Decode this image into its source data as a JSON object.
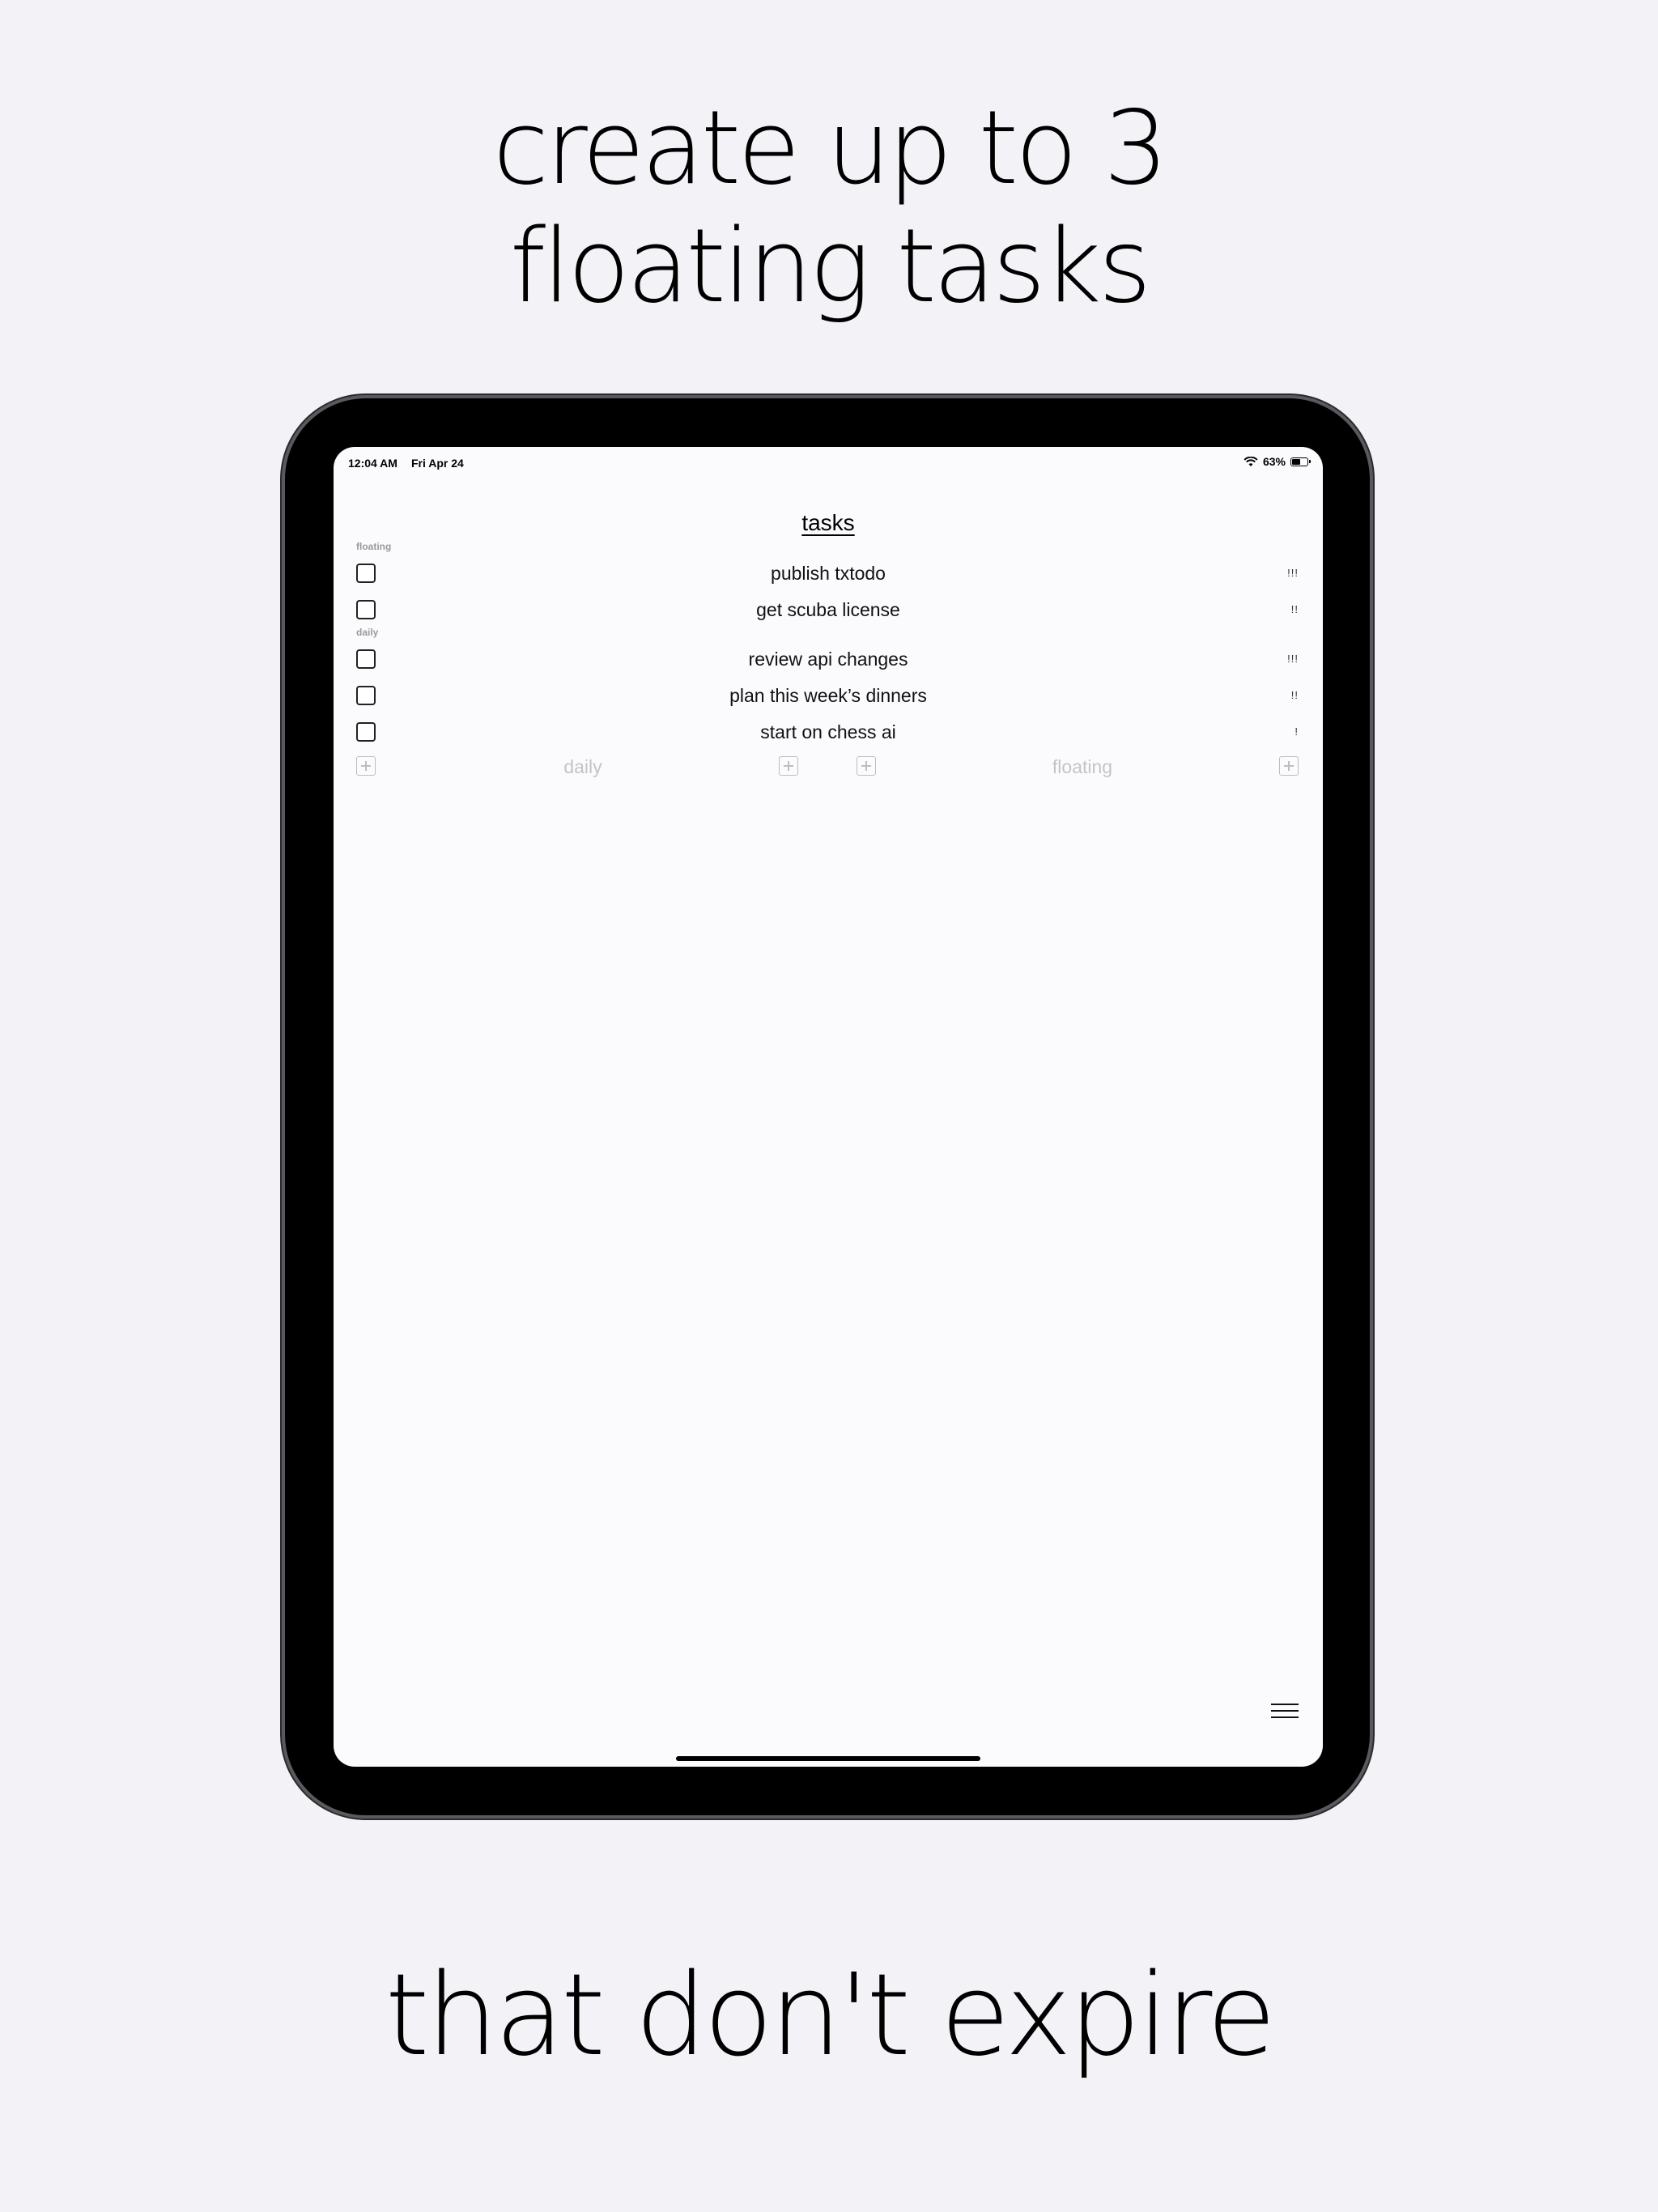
{
  "headline": {
    "line1": "create up to 3",
    "line2": "floating tasks",
    "bottom": "that don't expire"
  },
  "status_bar": {
    "time": "12:04 AM",
    "date": "Fri Apr 24",
    "battery": "63%",
    "battery_level": 0.63
  },
  "app": {
    "title": "tasks",
    "sections": [
      {
        "label": "floating",
        "tasks": [
          {
            "text": "publish txtodo",
            "priority": "!!!"
          },
          {
            "text": "get scuba license",
            "priority": "!!"
          }
        ]
      },
      {
        "label": "daily",
        "tasks": [
          {
            "text": "review api changes",
            "priority": "!!!"
          },
          {
            "text": "plan this week’s dinners",
            "priority": "!!"
          },
          {
            "text": "start on chess ai",
            "priority": "!"
          }
        ]
      }
    ],
    "add": {
      "daily_placeholder": "daily",
      "floating_placeholder": "floating"
    }
  }
}
